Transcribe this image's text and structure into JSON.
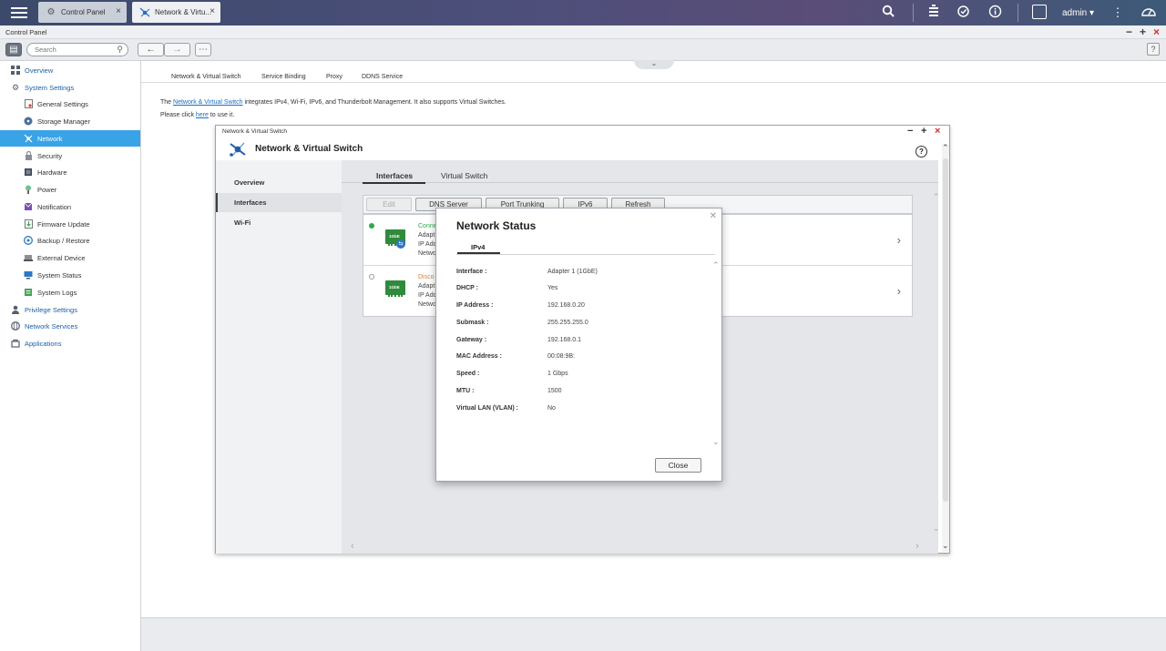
{
  "topbar": {
    "tabs": [
      {
        "label": "Control Panel",
        "icon": "gear-icon"
      },
      {
        "label": "Network & Virtu...",
        "icon": "network-icon"
      }
    ],
    "user": "admin",
    "colors": {
      "bar_start": "#3b4a6b",
      "bar_end": "#3d5a78"
    }
  },
  "window": {
    "title": "Control Panel"
  },
  "toolbar": {
    "search_placeholder": "Search"
  },
  "sidebar": {
    "items": [
      {
        "label": "Overview",
        "level": "top"
      },
      {
        "label": "System Settings",
        "level": "top"
      },
      {
        "label": "General Settings",
        "level": "sub"
      },
      {
        "label": "Storage Manager",
        "level": "sub"
      },
      {
        "label": "Network",
        "level": "sub",
        "active": true
      },
      {
        "label": "Security",
        "level": "sub"
      },
      {
        "label": "Hardware",
        "level": "sub"
      },
      {
        "label": "Power",
        "level": "sub"
      },
      {
        "label": "Notification",
        "level": "sub"
      },
      {
        "label": "Firmware Update",
        "level": "sub"
      },
      {
        "label": "Backup / Restore",
        "level": "sub"
      },
      {
        "label": "External Device",
        "level": "sub"
      },
      {
        "label": "System Status",
        "level": "sub"
      },
      {
        "label": "System Logs",
        "level": "sub"
      },
      {
        "label": "Privilege Settings",
        "level": "top"
      },
      {
        "label": "Network Services",
        "level": "top"
      },
      {
        "label": "Applications",
        "level": "top"
      }
    ],
    "accent": "#3aa2e6"
  },
  "main": {
    "tabs": [
      "Network & Virtual Switch",
      "Service Binding",
      "Proxy",
      "DDNS Service"
    ],
    "desc1_pre": "The ",
    "desc1_link": "Network & Virtual Switch",
    "desc1_post": " integrates IPv4, Wi-Fi, IPv6, and Thunderbolt Management. It also supports Virtual Switches.",
    "desc2_pre": "Please click ",
    "desc2_link": "here",
    "desc2_post": " to use it."
  },
  "nvs": {
    "window_title": "Network & Virtual Switch",
    "header": "Network & Virtual Switch",
    "side": [
      "Overview",
      "Interfaces",
      "Wi-Fi"
    ],
    "tabs": [
      "Interfaces",
      "Virtual Switch"
    ],
    "actions": [
      "Edit",
      "DNS Server",
      "Port Trunking",
      "IPv6",
      "Refresh"
    ],
    "interfaces": [
      {
        "status": "Conne",
        "line2": "Adapt",
        "line3": "IP Add",
        "line4": "Netwo",
        "card": "1GbE",
        "dot_color": "#2fa84f"
      },
      {
        "status": "Disco",
        "line2": "Adapt",
        "line3": "IP Add",
        "line4": "Netwo",
        "card": "1GbE",
        "dot_color": "#ffffff"
      }
    ]
  },
  "modal": {
    "title": "Network Status",
    "tab": "IPv4",
    "rows": [
      {
        "label": "Interface :",
        "value": "Adapter 1 (1GbE)"
      },
      {
        "label": "DHCP :",
        "value": "Yes"
      },
      {
        "label": "IP Address :",
        "value": "192.168.0.20"
      },
      {
        "label": "Submask :",
        "value": "255.255.255.0"
      },
      {
        "label": "Gateway :",
        "value": "192.168.0.1"
      },
      {
        "label": "MAC Address :",
        "value": "00:08:9B:"
      },
      {
        "label": "Speed :",
        "value": "1 Gbps"
      },
      {
        "label": "MTU :",
        "value": "1500"
      },
      {
        "label": "Virtual LAN (VLAN) :",
        "value": "No"
      }
    ],
    "close_label": "Close"
  }
}
